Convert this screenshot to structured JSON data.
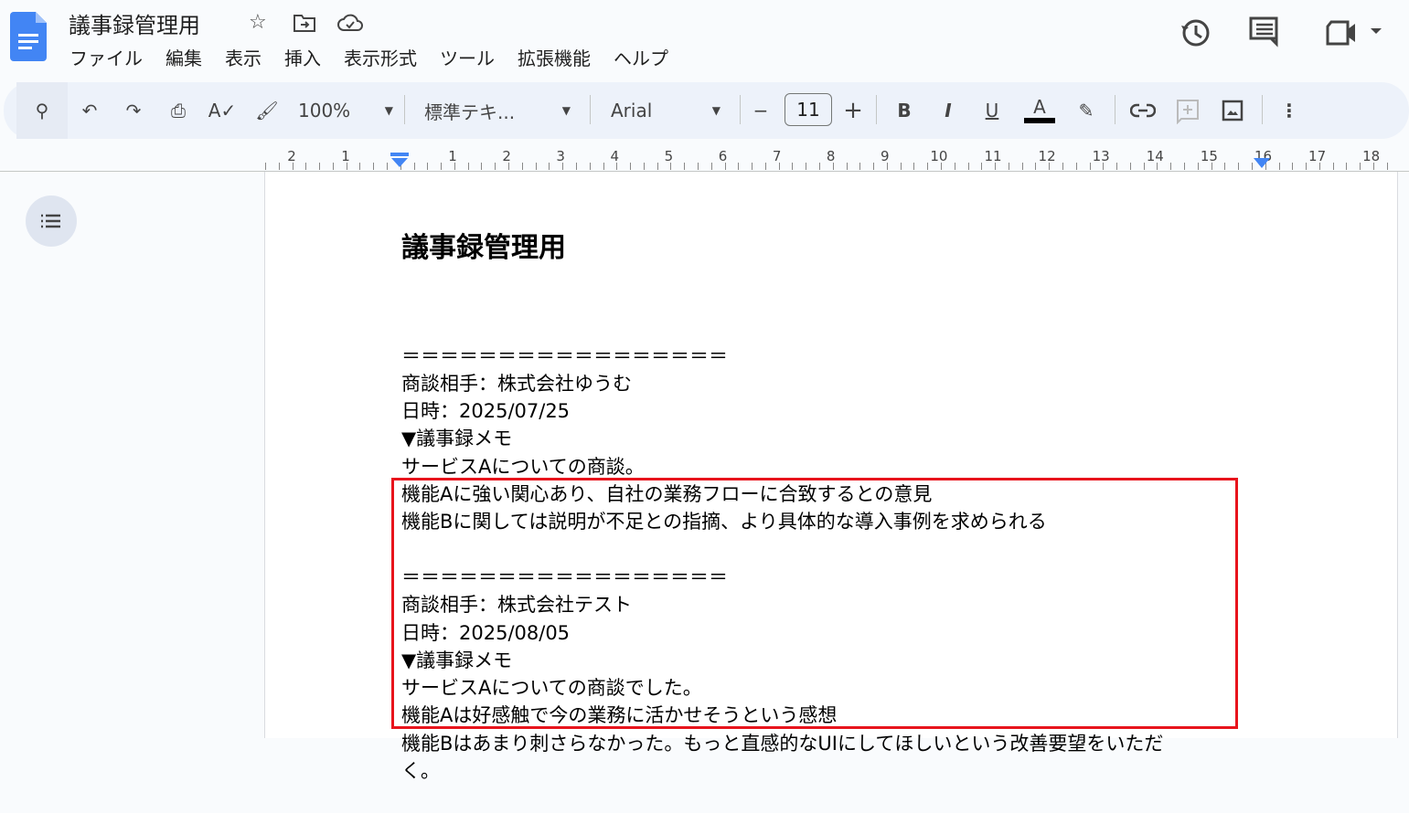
{
  "app": {
    "title": "議事録管理用",
    "menu": [
      "ファイル",
      "編集",
      "表示",
      "挿入",
      "表示形式",
      "ツール",
      "拡張機能",
      "ヘルプ"
    ]
  },
  "toolbar": {
    "zoom": "100%",
    "style": "標準テキ...",
    "font": "Arial",
    "font_size": "11",
    "minus": "−",
    "plus": "+",
    "bold": "B",
    "italic": "I",
    "underline": "U",
    "text_color": "A",
    "text_color_value": "#000000"
  },
  "ruler": {
    "labels": [
      "2",
      "1",
      "1",
      "2",
      "3",
      "4",
      "5",
      "6",
      "7",
      "8",
      "9",
      "10",
      "11",
      "12",
      "13",
      "14",
      "15",
      "16",
      "17",
      "18"
    ]
  },
  "document": {
    "heading": "議事録管理用",
    "lines": [
      "＝＝＝＝＝＝＝＝＝＝＝＝＝＝＝＝＝",
      "商談相手：株式会社ゆうむ",
      "日時：2025/07/25",
      "▼議事録メモ",
      "サービスAについての商談。",
      "機能Aに強い関心あり、自社の業務フローに合致するとの意見",
      "機能Bに関しては説明が不足との指摘、より具体的な導入事例を求められる",
      "",
      "＝＝＝＝＝＝＝＝＝＝＝＝＝＝＝＝＝",
      "商談相手：株式会社テスト",
      "日時：2025/08/05",
      "▼議事録メモ",
      "サービスAについての商談でした。",
      "機能Aは好感触で今の業務に活かせそうという感想",
      "機能Bはあまり刺さらなかった。もっと直感的なUIにしてほしいという改善要望をいただ",
      "く。"
    ]
  },
  "highlight_color": "#e8141c"
}
